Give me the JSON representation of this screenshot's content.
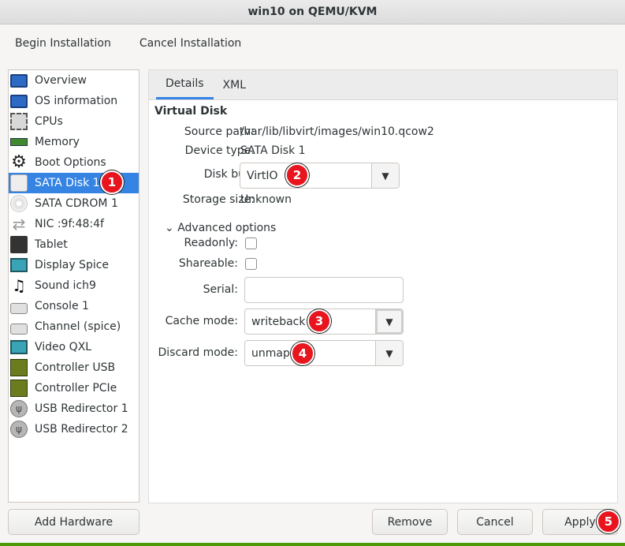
{
  "window": {
    "title": "win10 on QEMU/KVM"
  },
  "menu": {
    "begin": "Begin Installation",
    "cancel": "Cancel Installation"
  },
  "sidebar": {
    "items": [
      {
        "label": "Overview",
        "icon": "monitor-icon"
      },
      {
        "label": "OS information",
        "icon": "monitor-icon"
      },
      {
        "label": "CPUs",
        "icon": "cpu-chip-icon"
      },
      {
        "label": "Memory",
        "icon": "memory-icon"
      },
      {
        "label": "Boot Options",
        "icon": "gear-icon"
      },
      {
        "label": "SATA Disk 1",
        "icon": "hard-disk-icon",
        "selected": true
      },
      {
        "label": "SATA CDROM 1",
        "icon": "cdrom-icon"
      },
      {
        "label": "NIC :9f:48:4f",
        "icon": "network-icon"
      },
      {
        "label": "Tablet",
        "icon": "tablet-icon"
      },
      {
        "label": "Display Spice",
        "icon": "display-icon"
      },
      {
        "label": "Sound ich9",
        "icon": "sound-icon"
      },
      {
        "label": "Console 1",
        "icon": "console-icon"
      },
      {
        "label": "Channel (spice)",
        "icon": "channel-icon"
      },
      {
        "label": "Video QXL",
        "icon": "video-icon"
      },
      {
        "label": "Controller USB",
        "icon": "controller-icon"
      },
      {
        "label": "Controller PCIe",
        "icon": "controller-icon"
      },
      {
        "label": "USB Redirector 1",
        "icon": "usb-icon"
      },
      {
        "label": "USB Redirector 2",
        "icon": "usb-icon"
      }
    ],
    "add_hardware": "Add Hardware"
  },
  "tabs": {
    "details": "Details",
    "xml": "XML"
  },
  "disk": {
    "section_title": "Virtual Disk",
    "source_path_label": "Source path:",
    "source_path": "/var/lib/libvirt/images/win10.qcow2",
    "device_type_label": "Device type:",
    "device_type": "SATA Disk 1",
    "disk_bus_label": "Disk bus:",
    "disk_bus": "VirtIO",
    "storage_size_label": "Storage size:",
    "storage_size": "Unknown",
    "advanced_label": "Advanced options",
    "readonly_label": "Readonly:",
    "shareable_label": "Shareable:",
    "serial_label": "Serial:",
    "serial_value": "",
    "cache_mode_label": "Cache mode:",
    "cache_mode": "writeback",
    "discard_mode_label": "Discard mode:",
    "discard_mode": "unmap"
  },
  "buttons": {
    "remove": "Remove",
    "cancel": "Cancel",
    "apply": "Apply"
  },
  "markers": [
    "1",
    "2",
    "3",
    "4",
    "5"
  ],
  "colors": {
    "selection": "#3584e4",
    "marker": "#e8141e"
  }
}
